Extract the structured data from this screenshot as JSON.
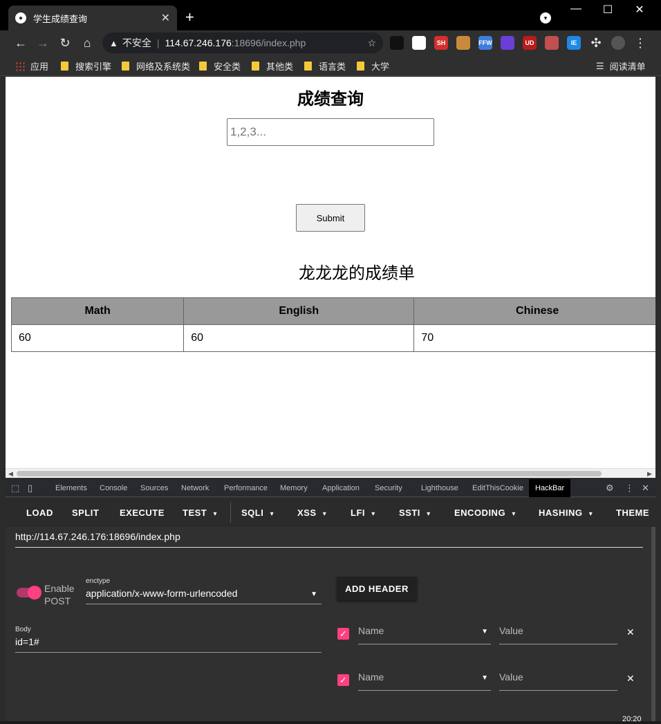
{
  "browser": {
    "tab": {
      "title": "学生成绩查询",
      "favicon": "globe-icon"
    },
    "window_controls": [
      "—",
      "☐",
      "✕"
    ],
    "address": {
      "security_label": "不安全",
      "host": "114.67.246.176",
      "port_path": ":18696/index.php"
    },
    "extensions": [
      {
        "name": "ext-dark",
        "label": "",
        "color": "#111111"
      },
      {
        "name": "ext-bird",
        "label": "",
        "color": "#ffffff"
      },
      {
        "name": "ext-sh",
        "label": "SH",
        "color": "#d32f2f"
      },
      {
        "name": "ext-cookie",
        "label": "",
        "color": "#c88a3a"
      },
      {
        "name": "ext-ffw",
        "label": "FFW",
        "color": "#3f7ddb"
      },
      {
        "name": "ext-cube",
        "label": "",
        "color": "#6a3fd8"
      },
      {
        "name": "ext-ud",
        "label": "UD",
        "color": "#b71c1c"
      },
      {
        "name": "ext-red",
        "label": "",
        "color": "#c05050"
      },
      {
        "name": "ext-ie",
        "label": "IE",
        "color": "#1e88e5"
      }
    ],
    "bookmarks": [
      {
        "label": "应用",
        "kind": "apps"
      },
      {
        "label": "搜索引擎",
        "kind": "folder"
      },
      {
        "label": "网络及系统类",
        "kind": "folder"
      },
      {
        "label": "安全类",
        "kind": "folder"
      },
      {
        "label": "其他类",
        "kind": "folder"
      },
      {
        "label": "语言类",
        "kind": "folder"
      },
      {
        "label": "大学",
        "kind": "folder"
      }
    ],
    "reading_list": "阅读清单"
  },
  "page": {
    "title": "成绩查询",
    "input_placeholder": "1,2,3...",
    "submit_label": "Submit",
    "report_title": "龙龙龙的成绩单",
    "table": {
      "headers": [
        "Math",
        "English",
        "Chinese"
      ],
      "rows": [
        [
          "60",
          "60",
          "70"
        ]
      ]
    }
  },
  "devtools": {
    "tabs": [
      "Elements",
      "Console",
      "Sources",
      "Network",
      "Performance",
      "Memory",
      "Application",
      "Security",
      "Lighthouse",
      "EditThisCookie",
      "HackBar"
    ],
    "active_tab": "HackBar"
  },
  "hackbar": {
    "menu": [
      "LOAD",
      "SPLIT",
      "EXECUTE",
      "TEST",
      "SQLI",
      "XSS",
      "LFI",
      "SSTI",
      "ENCODING",
      "HASHING",
      "THEME"
    ],
    "url": "http://114.67.246.176:18696/index.php",
    "post_toggle_label": "Enable POST",
    "post_enabled": true,
    "enctype_label": "enctype",
    "enctype_value": "application/x-www-form-urlencoded",
    "add_header_label": "ADD HEADER",
    "body_label": "Body",
    "body_value": "id=1#",
    "headers": [
      {
        "enabled": true,
        "name_placeholder": "Name",
        "value_placeholder": "Value"
      },
      {
        "enabled": true,
        "name_placeholder": "Name",
        "value_placeholder": "Value"
      }
    ],
    "accent_color": "#ff4081"
  },
  "system": {
    "clock": "20:20"
  }
}
